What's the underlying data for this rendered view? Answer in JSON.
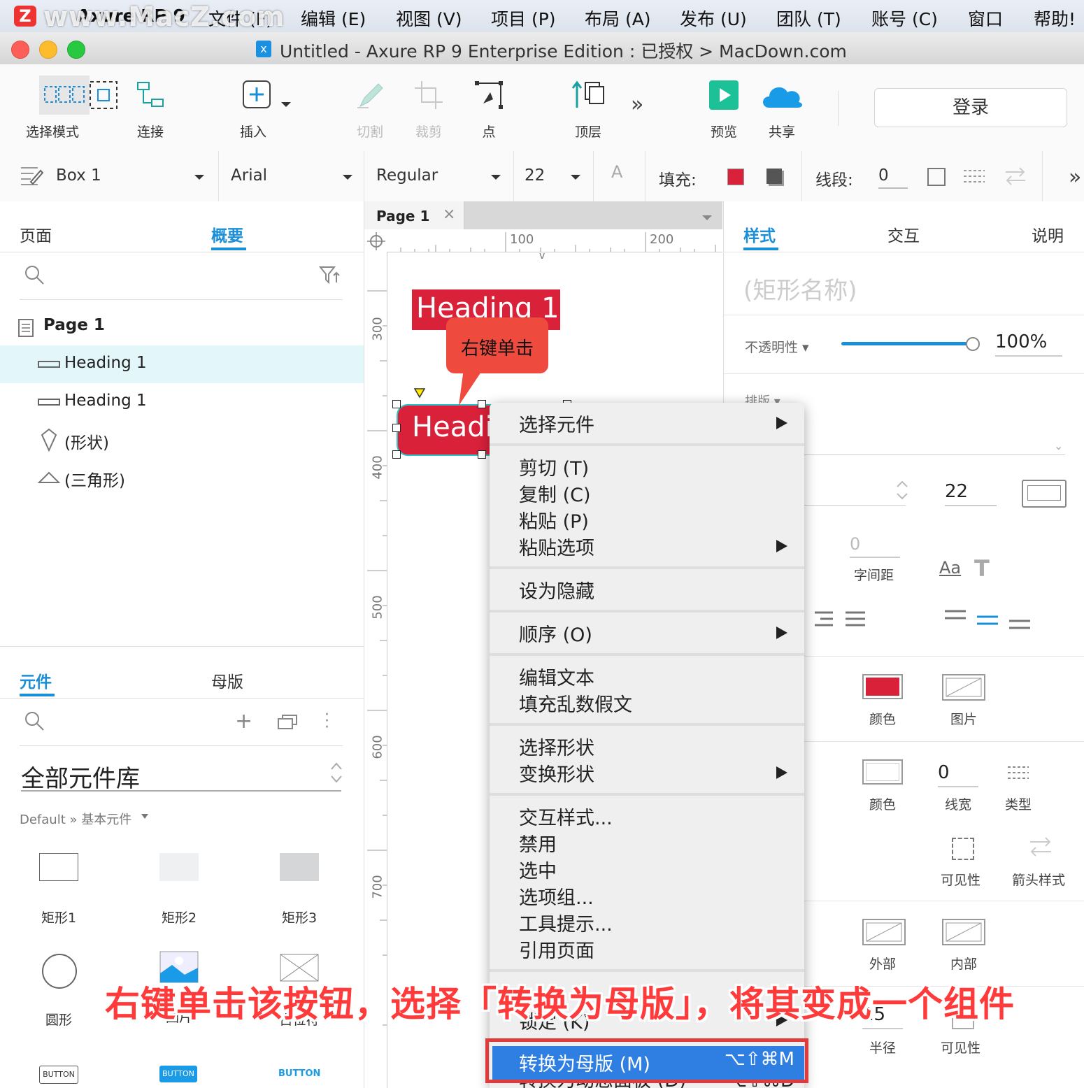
{
  "menubar": {
    "watermark": "www.MacZ.com",
    "items": [
      "Axure RP 9",
      "文件 (F)",
      "编辑 (E)",
      "视图 (V)",
      "项目 (P)",
      "布局 (A)",
      "发布 (U)",
      "团队 (T)",
      "账号 (C)",
      "窗口",
      "帮助!"
    ]
  },
  "window": {
    "title": "Untitled - Axure RP 9 Enterprise Edition : 已授权 > MacDown.com"
  },
  "toolbar": {
    "select_mode": "选择模式",
    "connect": "连接",
    "insert": "插入",
    "slice": "切割",
    "crop": "裁剪",
    "point": "点",
    "top": "顶层",
    "more": "»",
    "preview": "预览",
    "share": "共享",
    "login": "登录"
  },
  "formatbar": {
    "widget_name": "Box 1",
    "font": "Arial",
    "weight": "Regular",
    "size": "22",
    "fill_label": "填充:",
    "stroke_label": "线段:",
    "stroke_value": "0",
    "more": "»"
  },
  "left": {
    "tabs": [
      "页面",
      "概要"
    ],
    "tree": [
      {
        "label": "Page 1"
      },
      {
        "label": "Heading 1"
      },
      {
        "label": "Heading 1"
      },
      {
        "label": "(形状)"
      },
      {
        "label": "(三角形)"
      }
    ],
    "lib_tabs": [
      "元件",
      "母版"
    ],
    "library_select": "全部元件库",
    "breadcrumb": "Default » 基本元件",
    "widgets": [
      "矩形1",
      "矩形2",
      "矩形3",
      "圆形",
      "图片",
      "占位符"
    ],
    "buttons": [
      "BUTTON",
      "BUTTON",
      "BUTTON"
    ]
  },
  "canvas": {
    "tab": "Page 1",
    "ruler_h": [
      "100",
      "200"
    ],
    "ruler_v": [
      "300",
      "400",
      "500",
      "600",
      "700"
    ],
    "heading_top": "Heading 1",
    "heading_btn": "Headi",
    "callout": "右键单击"
  },
  "right": {
    "tabs": [
      "样式",
      "交互",
      "说明"
    ],
    "name_placeholder": "(矩形名称)",
    "opacity_label": "不透明性 ▾",
    "opacity_value": "100%",
    "opacity": 1.0,
    "typography_label": "排版 ▾",
    "font_size": "22",
    "line_spacing": "0",
    "char_spacing_label": "字间距",
    "fill_color_label": "颜色",
    "fill_image_label": "图片",
    "border_color_label": "颜色",
    "border_width_value": "0",
    "border_width_label": "线宽",
    "border_type_label": "类型",
    "visibility_label": "可见性",
    "arrow_label": "箭头样式",
    "shadow_outer": "外部",
    "shadow_inner": "内部",
    "radius_value": "15",
    "radius_label": "半径",
    "visibility2_label": "可见性"
  },
  "context_menu": {
    "select_widget": "选择元件",
    "cut": "剪切 (T)",
    "copy": "复制 (C)",
    "paste": "粘贴 (P)",
    "paste_options": "粘贴选项",
    "hide": "设为隐藏",
    "order": "顺序 (O)",
    "edit_text": "编辑文本",
    "fill_lorem": "填充乱数假文",
    "select_shape": "选择形状",
    "transform_shape": "变换形状",
    "interaction_styles": "交互样式...",
    "disable": "禁用",
    "selected": "选中",
    "option_group": "选项组...",
    "tooltip": "工具提示...",
    "ref_page": "引用页面",
    "lock": "锁定 (K)",
    "convert_master": "转换为母版 (M)",
    "convert_master_shortcut": "⌥⇧⌘M",
    "convert_dynamic": "转换为动态面板 (D)",
    "convert_dynamic_shortcut": "⌥⇧⌘D"
  },
  "subtitle": "右键单击该按钮，选择「转换为母版」，将其变成一个组件",
  "colors": {
    "accent": "#1a8fd8",
    "red": "#d9213a",
    "highlight": "#2f7fe3"
  }
}
